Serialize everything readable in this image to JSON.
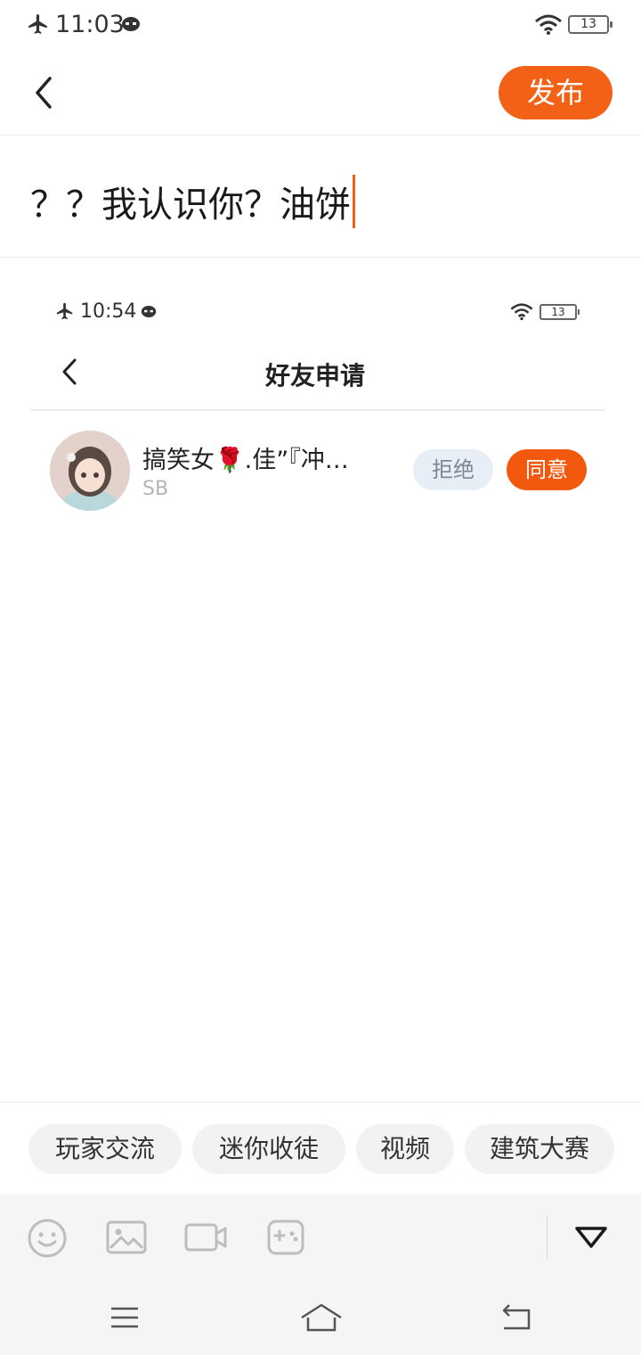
{
  "status_bar": {
    "time": "11:03",
    "battery": "13"
  },
  "header": {
    "publish_label": "发布"
  },
  "post": {
    "text": "？？我认识你？油饼"
  },
  "embedded_screenshot": {
    "status_time": "10:54",
    "battery": "13",
    "title": "好友申请",
    "request": {
      "name": "搞笑女🌹.佳”『冲…",
      "note": "SB",
      "reject_label": "拒绝",
      "agree_label": "同意"
    }
  },
  "tags": [
    "玩家交流",
    "迷你收徒",
    "视频",
    "建筑大赛"
  ],
  "toolbar": {
    "icons": [
      "emoji-icon",
      "image-icon",
      "video-icon",
      "game-icon",
      "collapse-icon"
    ]
  },
  "nav": {
    "icons": [
      "menu-icon",
      "home-icon",
      "back-icon"
    ]
  },
  "colors": {
    "accent": "#f26115",
    "reject_bg": "#e8eef5"
  }
}
